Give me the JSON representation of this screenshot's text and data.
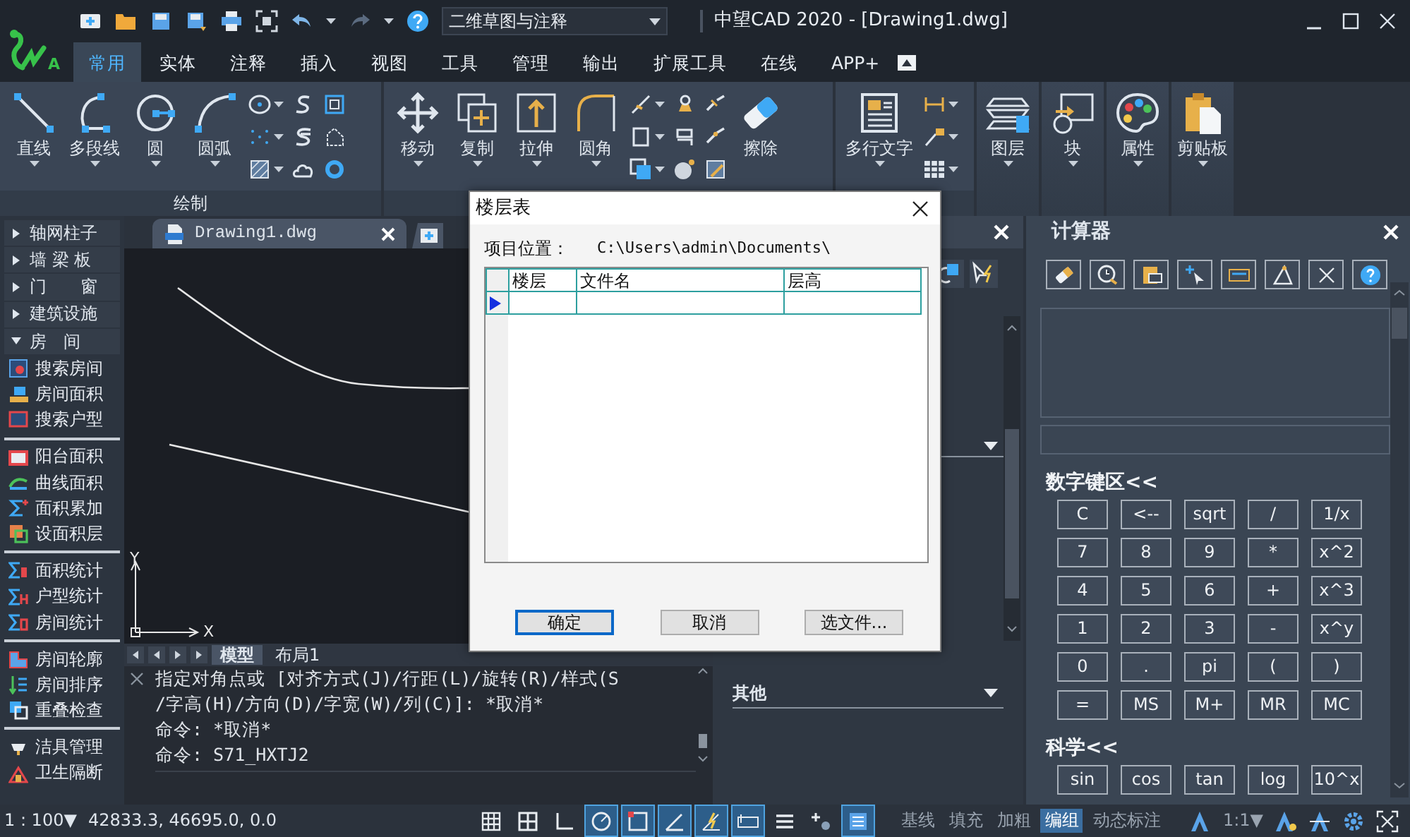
{
  "window": {
    "title": "中望CAD 2020 - [Drawing1.dwg]",
    "logo_badge": "A"
  },
  "quick_access": {
    "workspace": "二维草图与注释"
  },
  "ribbon_tabs": [
    {
      "label": "常用",
      "selected": true
    },
    {
      "label": "实体",
      "selected": false
    },
    {
      "label": "注释",
      "selected": false
    },
    {
      "label": "插入",
      "selected": false
    },
    {
      "label": "视图",
      "selected": false
    },
    {
      "label": "工具",
      "selected": false
    },
    {
      "label": "管理",
      "selected": false
    },
    {
      "label": "输出",
      "selected": false
    },
    {
      "label": "扩展工具",
      "selected": false
    },
    {
      "label": "在线",
      "selected": false
    },
    {
      "label": "APP+",
      "selected": false
    }
  ],
  "ribbon_panels": [
    {
      "label": "绘制",
      "tools": [
        {
          "kind": "large",
          "label": "直线",
          "dropdown": true
        },
        {
          "kind": "large",
          "label": "多段线",
          "dropdown": true
        },
        {
          "kind": "large",
          "label": "圆",
          "dropdown": true
        },
        {
          "kind": "large",
          "label": "圆弧",
          "dropdown": true
        },
        {
          "kind": "small",
          "dropdown": true
        },
        {
          "kind": "small",
          "dropdown": true
        },
        {
          "kind": "small",
          "dropdown": true
        },
        {
          "kind": "small",
          "dropdown": false
        },
        {
          "kind": "small",
          "dropdown": false
        },
        {
          "kind": "small",
          "dropdown": false
        },
        {
          "kind": "small",
          "dropdown": false
        },
        {
          "kind": "small",
          "dropdown": false
        },
        {
          "kind": "small",
          "dropdown": false
        }
      ]
    },
    {
      "tools": [
        {
          "kind": "large",
          "label": "移动",
          "dropdown": true
        },
        {
          "kind": "large",
          "label": "复制",
          "dropdown": true
        },
        {
          "kind": "large",
          "label": "拉伸",
          "dropdown": true
        },
        {
          "kind": "large",
          "label": "圆角",
          "dropdown": true
        },
        {
          "kind": "small",
          "dropdown": true
        },
        {
          "kind": "small",
          "dropdown": true
        },
        {
          "kind": "small",
          "dropdown": true
        },
        {
          "kind": "small",
          "dropdown": false
        },
        {
          "kind": "small",
          "dropdown": false
        },
        {
          "kind": "small",
          "dropdown": false
        },
        {
          "kind": "small",
          "dropdown": false
        },
        {
          "kind": "small",
          "dropdown": false
        },
        {
          "kind": "small",
          "dropdown": false
        },
        {
          "kind": "large",
          "label": "擦除",
          "dropdown": false
        }
      ]
    },
    {
      "tools": [
        {
          "kind": "large",
          "label": "多行文字",
          "dropdown": true
        },
        {
          "kind": "small",
          "dropdown": true
        },
        {
          "kind": "small",
          "dropdown": true
        },
        {
          "kind": "small",
          "dropdown": true
        }
      ]
    },
    {
      "tools": [
        {
          "kind": "large",
          "label": "图层",
          "dropdown": true
        }
      ]
    },
    {
      "tools": [
        {
          "kind": "large",
          "label": "块",
          "dropdown": true
        }
      ]
    },
    {
      "tools": [
        {
          "kind": "large",
          "label": "属性",
          "dropdown": true
        }
      ]
    },
    {
      "tools": [
        {
          "kind": "large",
          "label": "剪贴板",
          "dropdown": true
        }
      ]
    }
  ],
  "sidebar": {
    "items": [
      {
        "kind": "group",
        "label": "轴网柱子",
        "expanded": false
      },
      {
        "kind": "group",
        "label": "墙 梁 板",
        "expanded": false
      },
      {
        "kind": "group",
        "label": "门　　窗",
        "expanded": false
      },
      {
        "kind": "group",
        "label": "建筑设施",
        "expanded": false
      },
      {
        "kind": "group",
        "label": "房　间",
        "expanded": true,
        "children": [
          {
            "kind": "command",
            "label": "搜索房间"
          },
          {
            "kind": "command",
            "label": "房间面积"
          },
          {
            "kind": "command",
            "label": "搜索户型"
          },
          {
            "kind": "divider"
          },
          {
            "kind": "command",
            "label": "阳台面积"
          },
          {
            "kind": "command",
            "label": "曲线面积"
          },
          {
            "kind": "command",
            "label": "面积累加"
          },
          {
            "kind": "command",
            "label": "设面积层"
          },
          {
            "kind": "divider"
          },
          {
            "kind": "command",
            "label": "面积统计"
          },
          {
            "kind": "command",
            "label": "户型统计"
          },
          {
            "kind": "command",
            "label": "房间统计"
          },
          {
            "kind": "divider"
          },
          {
            "kind": "command",
            "label": "房间轮廓"
          },
          {
            "kind": "command",
            "label": "房间排序"
          },
          {
            "kind": "command",
            "label": "重叠检查"
          },
          {
            "kind": "divider"
          },
          {
            "kind": "command",
            "label": "洁具管理"
          },
          {
            "kind": "command",
            "label": "卫生隔断"
          }
        ]
      }
    ]
  },
  "document_tabs": [
    {
      "label": "Drawing1.dwg",
      "selected": true
    }
  ],
  "drawing": {
    "ucs": {
      "x": "X",
      "y": "Y"
    }
  },
  "layout_tabs": [
    {
      "label": "模型",
      "selected": true
    },
    {
      "label": "布局1",
      "selected": false
    }
  ],
  "command": {
    "history": [
      "指定对角点或 [对齐方式(J)/行距(L)/旋转(R)/样式(S",
      "/字高(H)/方向(D)/字宽(W)/列(C)]: *取消*",
      "命令: *取消*",
      "命令: S71_HXTJ2"
    ]
  },
  "properties_panel": {
    "section": "其他"
  },
  "dialog": {
    "title": "楼层表",
    "location_label": "项目位置：",
    "location_path": "C:\\Users\\admin\\Documents\\",
    "columns": [
      "楼层",
      "文件名",
      "层高"
    ],
    "rows": [
      {
        "current": true
      }
    ],
    "buttons": [
      {
        "label": "确定",
        "default": true
      },
      {
        "label": "取消",
        "default": false
      },
      {
        "label": "选文件...",
        "default": false
      }
    ]
  },
  "calculator": {
    "title": "计算器",
    "sections": [
      {
        "label": "数字键区<<",
        "keys": [
          "C",
          "7",
          "4",
          "1",
          "0",
          "=",
          "<--",
          "8",
          "5",
          "2",
          ".",
          "MS",
          "sqrt",
          "9",
          "6",
          "3",
          "pi",
          "M+",
          "/",
          "*",
          "+",
          "-",
          "(",
          "MR",
          "1/x",
          "x^2",
          "x^3",
          "x^y",
          ")",
          "MC"
        ]
      },
      {
        "label": "科学<<",
        "keys": [
          "sin",
          "cos",
          "tan",
          "log",
          "10^x"
        ]
      }
    ]
  },
  "status_bar": {
    "scale": "1 : 100▼",
    "coordinates": "42833.3, 46695.0, 0.0",
    "toggles": [
      {
        "on": false
      },
      {
        "on": false
      },
      {
        "on": false
      },
      {
        "on": true
      },
      {
        "on": true
      },
      {
        "on": true
      },
      {
        "on": true
      },
      {
        "on": true
      },
      {
        "on": false
      },
      {
        "on": false
      },
      {
        "on": true
      }
    ],
    "text_toggles": [
      {
        "label": "基线",
        "on": false
      },
      {
        "label": "填充",
        "on": false
      },
      {
        "label": "加粗",
        "on": false
      },
      {
        "label": "编组",
        "on": true
      },
      {
        "label": "动态标注",
        "on": false
      }
    ],
    "annotation_scale": "1:1▼"
  }
}
